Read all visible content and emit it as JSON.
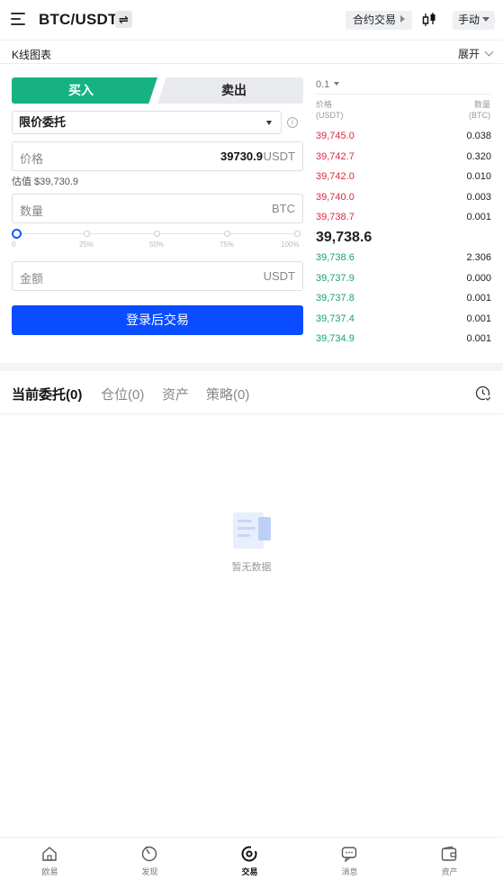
{
  "header": {
    "pair": "BTC/USDT",
    "swap_icon_glyph": "⇌",
    "contract_label": "合约交易",
    "mode_label": "手动"
  },
  "kline": {
    "label": "K线图表",
    "expand_label": "展开"
  },
  "trade": {
    "buy_label": "买入",
    "sell_label": "卖出",
    "order_type": "限价委托",
    "info_glyph": "i",
    "price_placeholder": "价格",
    "price_value": "39730.9",
    "price_unit": "USDT",
    "estimate": "估值 $39,730.9",
    "amount_placeholder": "数量",
    "amount_unit": "BTC",
    "slider_marks": [
      "0",
      "25%",
      "50%",
      "75%",
      "100%"
    ],
    "slider_value_percent": 0,
    "total_placeholder": "金额",
    "total_unit": "USDT",
    "login_button": "登录后交易"
  },
  "orderbook": {
    "precision": "0.1",
    "price_header": "价格",
    "price_unit": "(USDT)",
    "qty_header": "数量",
    "qty_unit": "(BTC)",
    "asks": [
      {
        "price": "39,745.0",
        "qty": "0.038"
      },
      {
        "price": "39,742.7",
        "qty": "0.320"
      },
      {
        "price": "39,742.0",
        "qty": "0.010"
      },
      {
        "price": "39,740.0",
        "qty": "0.003"
      },
      {
        "price": "39,738.7",
        "qty": "0.001"
      }
    ],
    "mid_price": "39,738.6",
    "bids": [
      {
        "price": "39,738.6",
        "qty": "2.306"
      },
      {
        "price": "39,737.9",
        "qty": "0.000"
      },
      {
        "price": "39,737.8",
        "qty": "0.001"
      },
      {
        "price": "39,737.4",
        "qty": "0.001"
      },
      {
        "price": "39,734.9",
        "qty": "0.001"
      }
    ],
    "ask_color": "#d82b3b",
    "bid_color": "#16a36e"
  },
  "orders": {
    "tabs": [
      "当前委托(0)",
      "仓位(0)",
      "资产",
      "策略(0)"
    ],
    "empty_text": "暂无数据"
  },
  "nav": {
    "items": [
      "欧易",
      "发现",
      "交易",
      "消息",
      "资产"
    ],
    "active_index": 2
  },
  "colors": {
    "buy": "#16b281",
    "primary": "#0a4cff"
  }
}
